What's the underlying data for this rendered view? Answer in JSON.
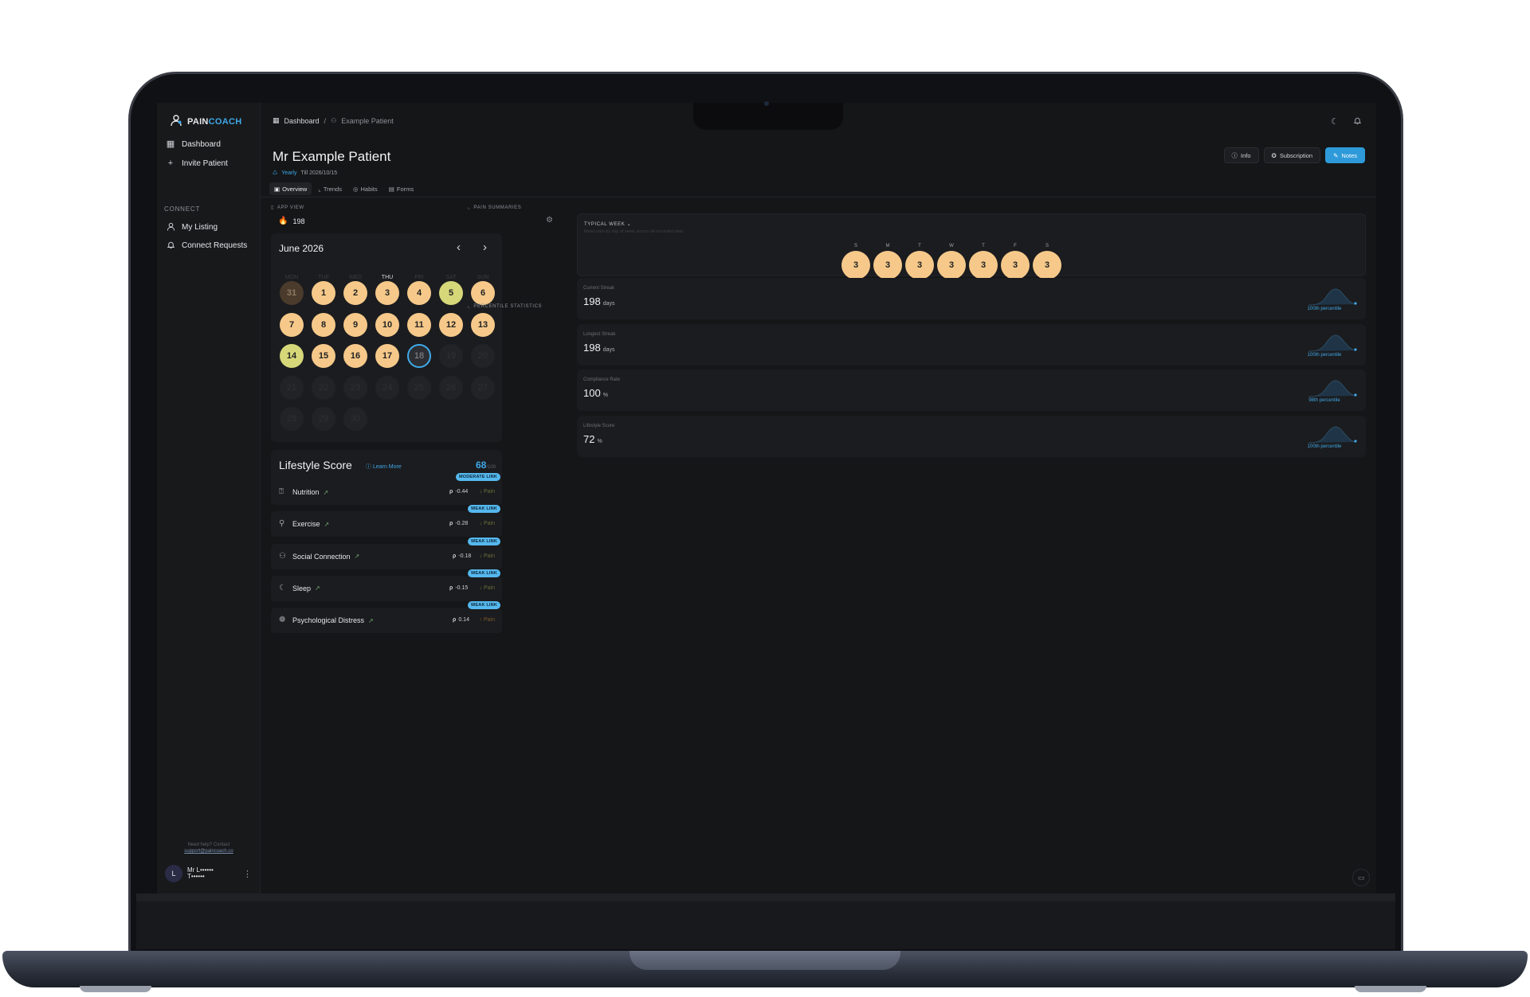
{
  "brand": {
    "pain": "PAIN",
    "coach": "COACH"
  },
  "sidebar": {
    "items": [
      {
        "label": "Dashboard",
        "icon": "grid-icon"
      },
      {
        "label": "Invite Patient",
        "icon": "plus-icon"
      }
    ],
    "section": "CONNECT",
    "connect_items": [
      {
        "label": "My Listing",
        "icon": "user-icon"
      },
      {
        "label": "Connect Requests",
        "icon": "bell-icon"
      }
    ],
    "help_text": "Need help? Contact",
    "help_email": "support@paincoach.co",
    "user": {
      "initial": "L",
      "name_line1": "Mr L••••••",
      "name_line2": "T••••••"
    }
  },
  "breadcrumb": {
    "root": "Dashboard",
    "sep": "/",
    "current": "Example Patient"
  },
  "patient": {
    "title": "Mr Example Patient",
    "plan": "Yearly",
    "till": "Till 2026/10/15"
  },
  "actions": {
    "info": "Info",
    "subscription": "Subscription",
    "notes": "Notes"
  },
  "tabs": [
    "Overview",
    "Trends",
    "Habits",
    "Forms"
  ],
  "app_view": {
    "label": "APP VIEW",
    "streak": "198"
  },
  "calendar": {
    "title": "June 2026",
    "weekdays": [
      "MON",
      "TUE",
      "WED",
      "THU",
      "FRI",
      "SAT",
      "SUN"
    ],
    "current_weekday": "THU"
  },
  "lifestyle": {
    "title": "Lifestyle Score",
    "learn": "Learn More",
    "score": "68",
    "denom": "/100",
    "fraction": 0.68
  },
  "habits": [
    {
      "name": "Nutrition",
      "badge": "MODERATE LINK",
      "rho": "-0.44",
      "pain": "↓ Pain",
      "icon": "apple-icon"
    },
    {
      "name": "Exercise",
      "badge": "WEAK LINK",
      "rho": "-0.28",
      "pain": "↓ Pain",
      "icon": "run-icon"
    },
    {
      "name": "Social Connection",
      "badge": "WEAK LINK",
      "rho": "-0.18",
      "pain": "↓ Pain",
      "icon": "people-icon"
    },
    {
      "name": "Sleep",
      "badge": "WEAK LINK",
      "rho": "-0.15",
      "pain": "↓ Pain",
      "icon": "moon-icon"
    },
    {
      "name": "Psychological Distress",
      "badge": "WEAK LINK",
      "rho": "0.14",
      "pain": "↑ Pain",
      "icon": "brain-icon"
    }
  ],
  "rho_symbol": "ρ",
  "pain_summaries": {
    "label": "PAIN SUMMARIES",
    "typical_week": "TYPICAL WEEK",
    "typical_week_sub": "Mean pain by day of week across all recorded data",
    "days": [
      {
        "d": "S",
        "v": "3"
      },
      {
        "d": "M",
        "v": "3"
      },
      {
        "d": "T",
        "v": "3"
      },
      {
        "d": "W",
        "v": "3"
      },
      {
        "d": "T",
        "v": "3"
      },
      {
        "d": "F",
        "v": "3"
      },
      {
        "d": "S",
        "v": "3"
      }
    ]
  },
  "percentiles": {
    "label": "PERCENTILE STATISTICS",
    "stats": [
      {
        "label": "Current Streak",
        "value": "198",
        "unit": "days",
        "pct": "100th percentile"
      },
      {
        "label": "Longest Streak",
        "value": "198",
        "unit": "days",
        "pct": "100th percentile"
      },
      {
        "label": "Compliance Rate",
        "value": "100",
        "unit": "%",
        "pct": "98th percentile"
      },
      {
        "label": "Lifestyle Score",
        "value": "72",
        "unit": "%",
        "pct": "100th percentile"
      }
    ]
  },
  "colors": {
    "accent": "#3fa9e8",
    "pain3": "#f6c98a",
    "pain2": "#d6d779"
  }
}
